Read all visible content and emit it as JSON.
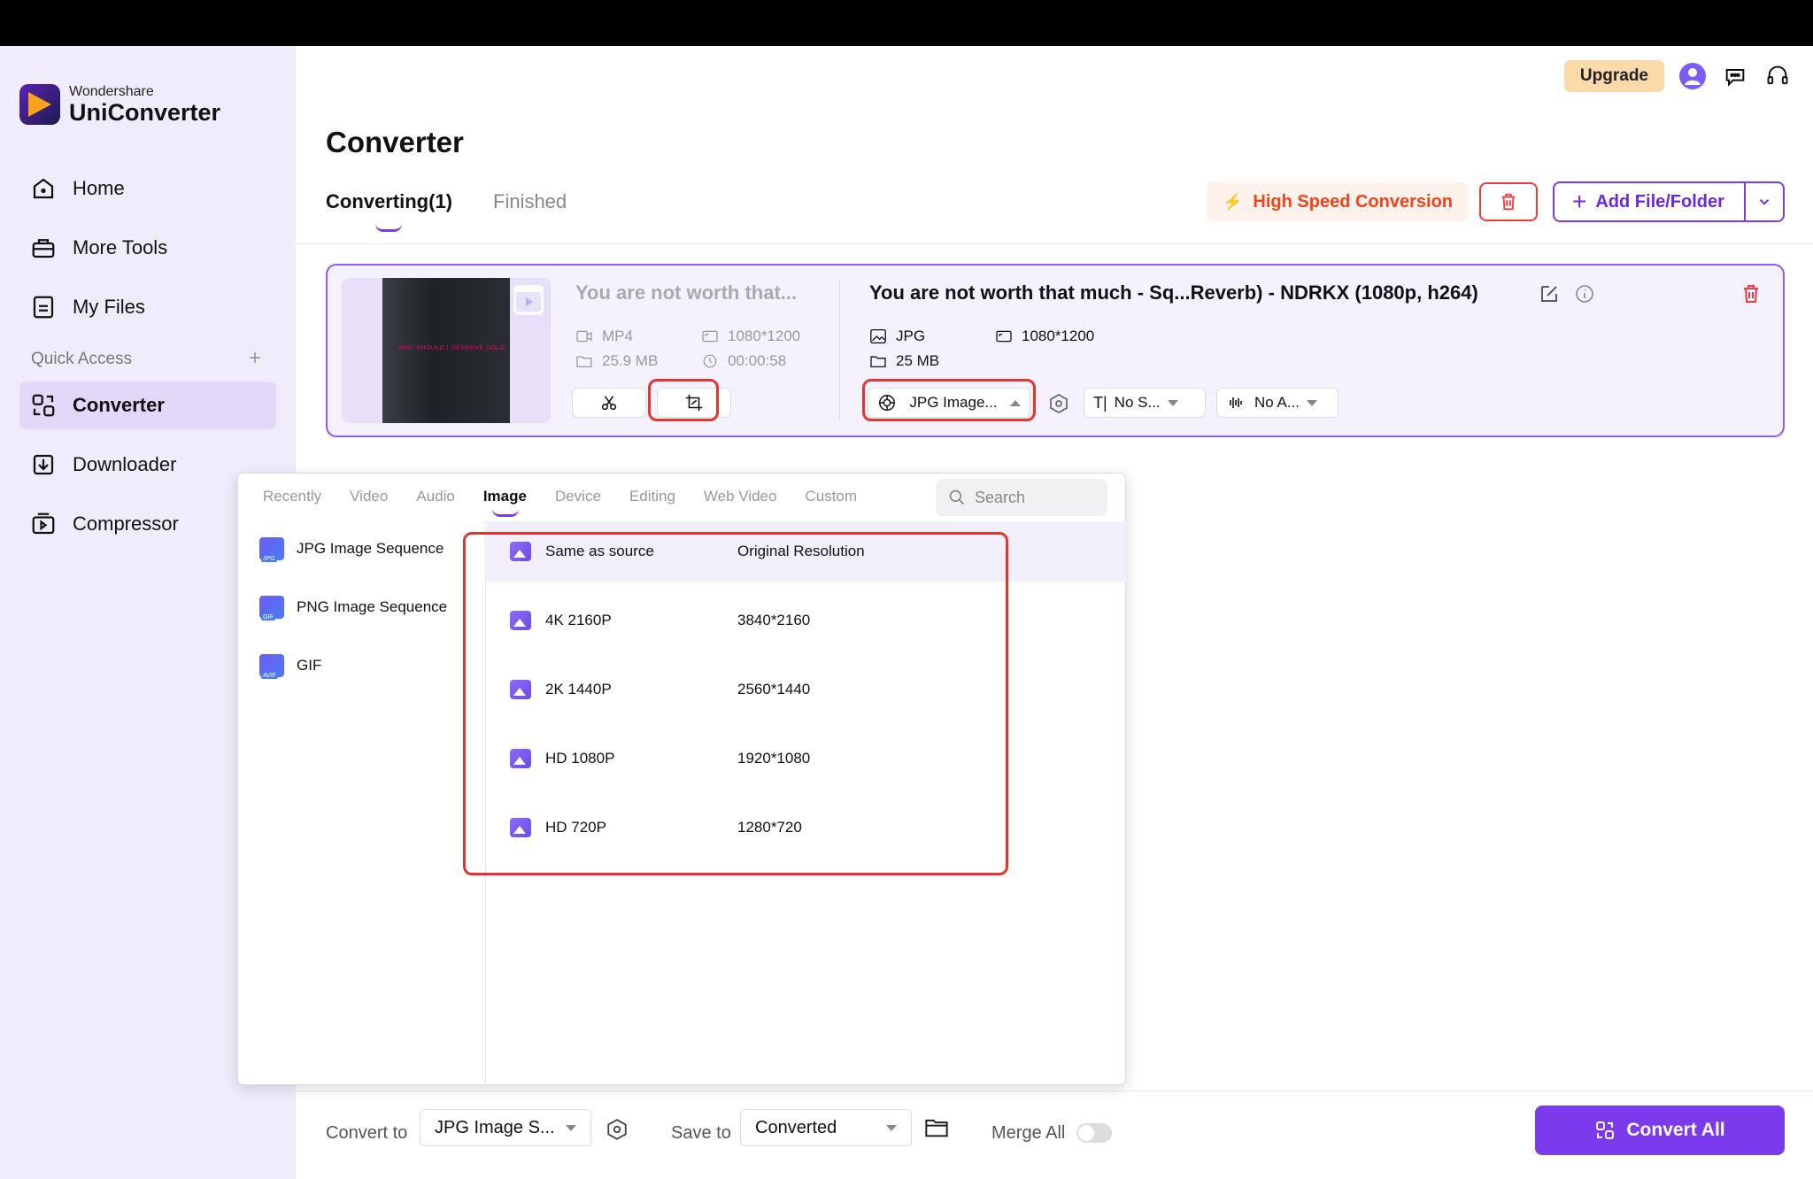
{
  "brand": {
    "small": "Wondershare",
    "big": "UniConverter"
  },
  "sidebar": {
    "items": [
      {
        "label": "Home"
      },
      {
        "label": "More Tools"
      },
      {
        "label": "My Files"
      },
      {
        "label": "Converter"
      },
      {
        "label": "Downloader"
      },
      {
        "label": "Compressor"
      }
    ],
    "quick_access": "Quick Access",
    "quick_plus": "+"
  },
  "top": {
    "upgrade": "Upgrade"
  },
  "page": {
    "title": "Converter",
    "tabs": [
      "Converting(1)",
      "Finished"
    ],
    "high_speed": "High Speed Conversion",
    "add_file": "Add File/Folder"
  },
  "file": {
    "source_title": "You are not worth that...",
    "source_format": "MP4",
    "source_size": "25.9 MB",
    "source_res": "1080*1200",
    "source_duration": "00:00:58",
    "thumb_text": "WHY SHOULD I DESERVE GOLD",
    "output_title": "You are not worth that much - Sq...Reverb) - NDRKX (1080p, h264)",
    "output_format": "JPG",
    "output_size": "25 MB",
    "output_res": "1080*1200",
    "format_select": "JPG Image...",
    "subtitle_select": "No S...",
    "audio_select": "No A..."
  },
  "dropdown": {
    "tabs": [
      "Recently",
      "Video",
      "Audio",
      "Image",
      "Device",
      "Editing",
      "Web Video",
      "Custom"
    ],
    "search_placeholder": "Search",
    "formats": [
      {
        "label": "JPG Image Sequence",
        "badge": "JPG"
      },
      {
        "label": "PNG Image Sequence",
        "badge": "GIF"
      },
      {
        "label": "GIF",
        "badge": "AVIF"
      }
    ],
    "resolutions": [
      {
        "name": "Same as source",
        "value": "Original Resolution"
      },
      {
        "name": "4K 2160P",
        "value": "3840*2160"
      },
      {
        "name": "2K 1440P",
        "value": "2560*1440"
      },
      {
        "name": "HD 1080P",
        "value": "1920*1080"
      },
      {
        "name": "HD 720P",
        "value": "1280*720"
      }
    ]
  },
  "bottom": {
    "convert_to_label": "Convert to",
    "convert_to_value": "JPG Image S...",
    "save_to_label": "Save to",
    "save_to_value": "Converted",
    "merge_all": "Merge All",
    "convert_all": "Convert All"
  },
  "colors": {
    "accent": "#7c3aed",
    "danger": "#e3342f",
    "sidebar_bg": "#f1ecfb"
  }
}
